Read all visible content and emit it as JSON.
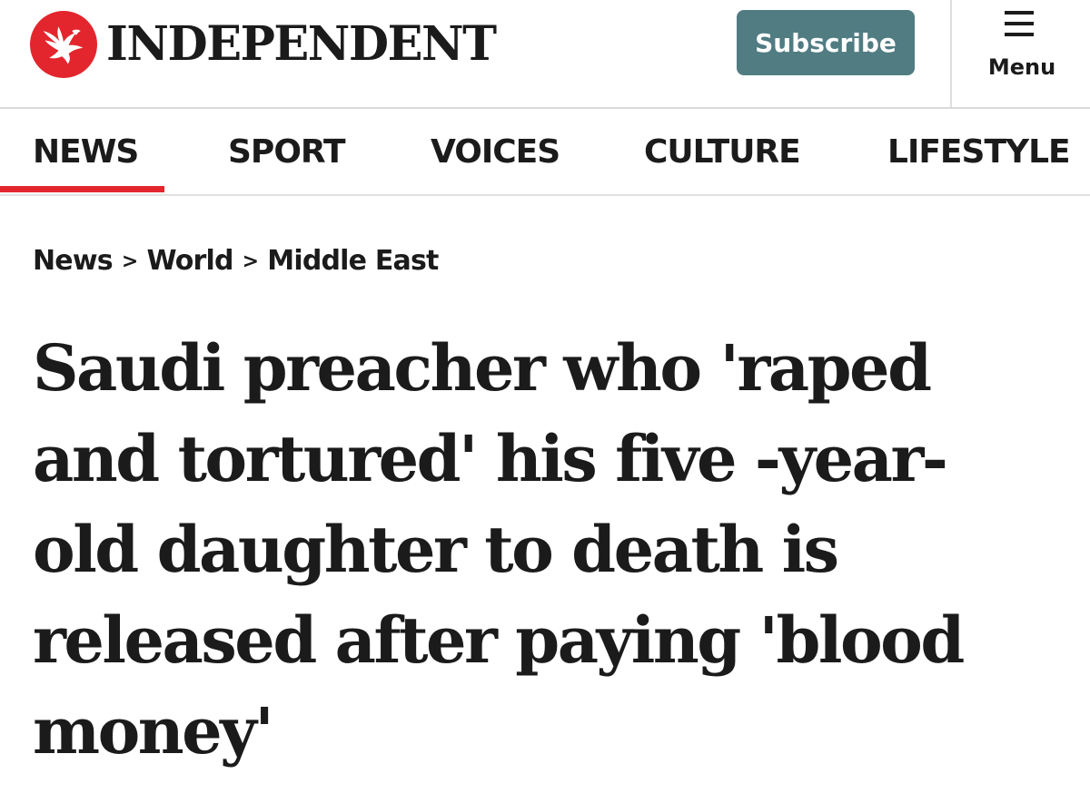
{
  "brand": {
    "name": "INDEPENDENT",
    "logo_icon": "eagle-icon",
    "accent_color": "#e3262d"
  },
  "header": {
    "subscribe_label": "Subscribe",
    "subscribe_color": "#507c82",
    "menu_icon": "hamburger-icon",
    "menu_label": "Menu"
  },
  "nav": {
    "active": "NEWS",
    "items": [
      {
        "label": "NEWS"
      },
      {
        "label": "SPORT"
      },
      {
        "label": "VOICES"
      },
      {
        "label": "CULTURE"
      },
      {
        "label": "LIFESTYLE"
      }
    ]
  },
  "breadcrumb": {
    "separator": ">",
    "items": [
      {
        "label": "News"
      },
      {
        "label": "World"
      },
      {
        "label": "Middle East"
      }
    ]
  },
  "article": {
    "headline_lines": [
      "Saudi preacher who 'raped",
      "and tortured' his five -year-",
      "old daughter to death is",
      "released after paying 'blood",
      "money'"
    ]
  }
}
